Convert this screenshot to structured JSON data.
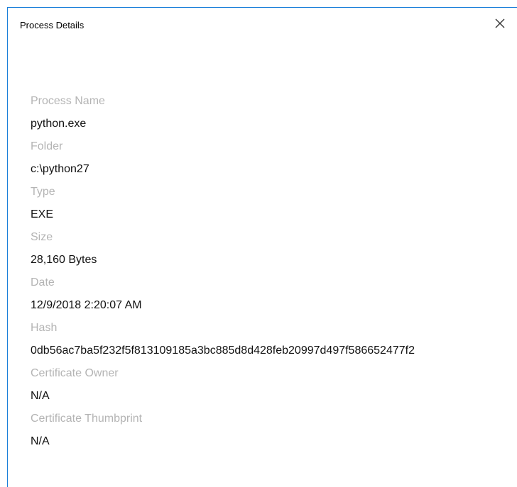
{
  "window": {
    "title": "Process Details",
    "close_icon": "close-icon",
    "border_color": "#1a7fd9"
  },
  "fields": [
    {
      "label": "Process Name",
      "value": "python.exe"
    },
    {
      "label": "Folder",
      "value": "c:\\python27"
    },
    {
      "label": "Type",
      "value": "EXE"
    },
    {
      "label": "Size",
      "value": "28,160 Bytes"
    },
    {
      "label": "Date",
      "value": "12/9/2018 2:20:07 AM"
    },
    {
      "label": "Hash",
      "value": "0db56ac7ba5f232f5f813109185a3bc885d8d428feb20997d497f586652477f2"
    },
    {
      "label": "Certificate Owner",
      "value": "N/A"
    },
    {
      "label": "Certificate Thumbprint",
      "value": "N/A"
    }
  ]
}
